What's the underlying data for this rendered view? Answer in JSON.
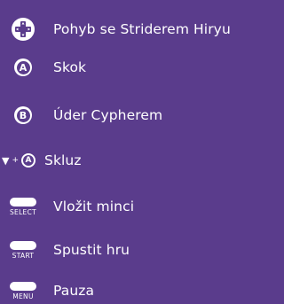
{
  "background": "#5a3c8c",
  "controls": [
    {
      "icon": "dpad-icon",
      "label": "Pohyb se Striderem Hiryu"
    },
    {
      "icon": "button-a-icon",
      "glyph": "A",
      "label": "Skok"
    },
    {
      "icon": "button-b-icon",
      "glyph": "B",
      "label": "Úder Cypherem"
    },
    {
      "icon": "down-plus-a-icon",
      "down_glyph": "▼",
      "plus_glyph": "+",
      "glyph": "A",
      "label": "Skluz"
    },
    {
      "icon": "select-button-icon",
      "caption": "SELECT",
      "label": "Vložit minci"
    },
    {
      "icon": "start-button-icon",
      "caption": "START",
      "label": "Spustit hru"
    },
    {
      "icon": "menu-button-icon",
      "caption": "MENU",
      "label": "Pauza"
    }
  ]
}
